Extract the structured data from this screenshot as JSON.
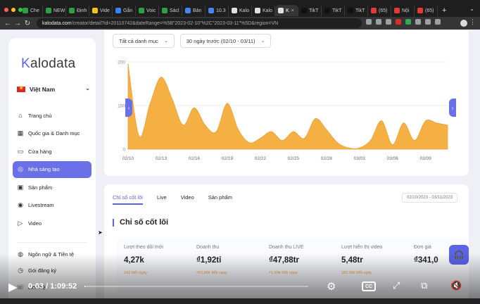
{
  "browser": {
    "tabs": [
      {
        "label": "Che",
        "color": "#2ea043",
        "active": false
      },
      {
        "label": "NEW",
        "color": "#2ea043",
        "active": false
      },
      {
        "label": "Định",
        "color": "#2ea043",
        "active": false
      },
      {
        "label": "Vide",
        "color": "#f1c40f",
        "active": false
      },
      {
        "label": "Gắn",
        "color": "#3b82f6",
        "active": false
      },
      {
        "label": "Voic",
        "color": "#2ea043",
        "active": false
      },
      {
        "label": "Sácl",
        "color": "#2ea043",
        "active": false
      },
      {
        "label": "Bản",
        "color": "#4285f4",
        "active": false
      },
      {
        "label": "10.3",
        "color": "#4285f4",
        "active": false
      },
      {
        "label": "Kalo",
        "color": "#e0e0e0",
        "active": false
      },
      {
        "label": "Kalo",
        "color": "#e0e0e0",
        "active": false
      },
      {
        "label": "K",
        "color": "#e0e0e0",
        "active": true
      },
      {
        "label": "TikT",
        "color": "#111111",
        "active": false
      },
      {
        "label": "TikT",
        "color": "#111111",
        "active": false
      },
      {
        "label": "TikT",
        "color": "#111111",
        "active": false
      },
      {
        "label": "(65)",
        "color": "#e53935",
        "active": false
      },
      {
        "label": "Nội",
        "color": "#e53935",
        "active": false
      },
      {
        "label": "(65)",
        "color": "#e53935",
        "active": false
      }
    ],
    "url_host": "kalodata.com",
    "url_path": "/creator/detail?id=20110742&dateRange=%5B\"2023-02-10\"%2C\"2023-03-11\"%5D&region=VN"
  },
  "sidebar": {
    "logo": "Kalodata",
    "country": "Việt Nam",
    "items": [
      {
        "label": "Trang chủ",
        "icon": "home-icon",
        "active": false
      },
      {
        "label": "Quốc gia & Danh mục",
        "icon": "store-icon",
        "active": false
      },
      {
        "label": "Cửa hàng",
        "icon": "shop-icon",
        "active": false
      },
      {
        "label": "Nhà sáng tạo",
        "icon": "creator-icon",
        "active": true
      },
      {
        "label": "Sản phẩm",
        "icon": "box-icon",
        "active": false
      },
      {
        "label": "Livestream",
        "icon": "broadcast-icon",
        "active": false
      },
      {
        "label": "Video",
        "icon": "video-icon",
        "active": false
      }
    ],
    "items2": [
      {
        "label": "Ngôn ngữ & Tiền tệ",
        "icon": "globe-icon"
      },
      {
        "label": "Gói đăng ký",
        "icon": "subscription-icon"
      },
      {
        "label": "Liên hệ",
        "icon": "contact-icon"
      }
    ]
  },
  "filters": {
    "category": "Tất cả danh mục",
    "date_range": "30 ngày trước (02/10 - 03/11)"
  },
  "chart_data": {
    "type": "area",
    "x_ticks": [
      "02/10",
      "02/13",
      "02/16",
      "02/19",
      "02/22",
      "02/25",
      "02/28",
      "03/03",
      "03/06",
      "03/09"
    ],
    "y_ticks": [
      "0",
      "100",
      "200"
    ],
    "ylim": [
      0,
      200
    ],
    "color": "#f5b043",
    "x": [
      "02/10",
      "02/11",
      "02/12",
      "02/13",
      "02/14",
      "02/15",
      "02/16",
      "02/17",
      "02/18",
      "02/19",
      "02/20",
      "02/21",
      "02/22",
      "02/23",
      "02/24",
      "02/25",
      "02/26",
      "02/27",
      "02/28",
      "03/01",
      "03/02",
      "03/03",
      "03/04",
      "03/05",
      "03/06",
      "03/07",
      "03/08",
      "03/09",
      "03/10",
      "03/11"
    ],
    "values": [
      195,
      30,
      105,
      165,
      115,
      55,
      95,
      55,
      40,
      105,
      45,
      15,
      25,
      40,
      20,
      40,
      25,
      70,
      45,
      15,
      3,
      3,
      20,
      65,
      10,
      60,
      20,
      65,
      60,
      55
    ]
  },
  "metrics_card": {
    "tabs": [
      {
        "label": "Chỉ số cốt lõi",
        "active": true
      },
      {
        "label": "Live",
        "active": false
      },
      {
        "label": "Video",
        "active": false
      },
      {
        "label": "Sản phẩm",
        "active": false
      }
    ],
    "date_range": "02/10/2023 - 03/11/2023",
    "section_title": "Chỉ số cốt lõi",
    "metrics": [
      {
        "label": "Lượt theo dõi mới",
        "value": "4,27k",
        "sub": "142 Mỗi ngày"
      },
      {
        "label": "Doanh thu",
        "value": "₫1,92tỉ",
        "sub": "₫63,89tr Mỗi ngày"
      },
      {
        "label": "Doanh thu LIVE",
        "value": "₫47,88tr",
        "sub": "₫1,60tr Mỗi ngày"
      },
      {
        "label": "Lượt hiển thị video",
        "value": "5,48tr",
        "sub": "182,58k Mỗi ngày"
      },
      {
        "label": "Đơn giá",
        "value": "₫341,0",
        "sub": ""
      }
    ]
  },
  "player": {
    "timecode": "0:03 / 1:09:52",
    "progress": 0.0007
  }
}
